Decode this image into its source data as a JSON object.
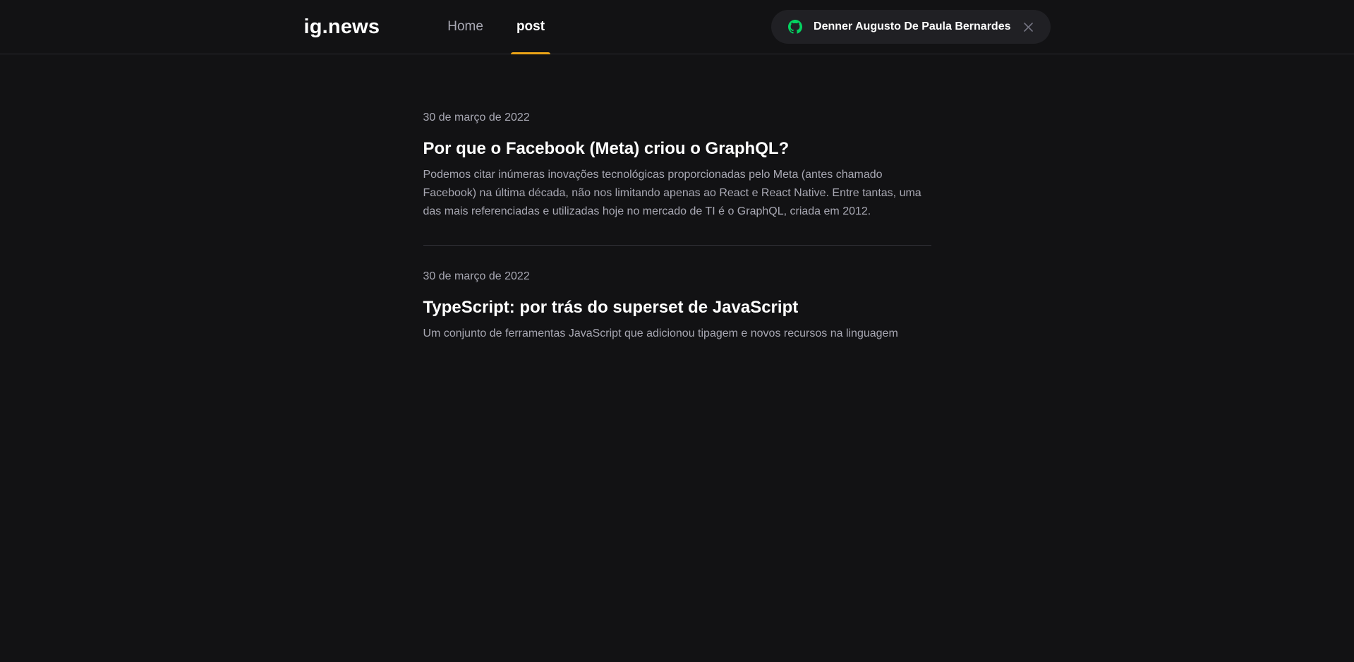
{
  "header": {
    "logo": "ig.news",
    "nav": [
      {
        "label": "Home",
        "active": false
      },
      {
        "label": "post",
        "active": true
      }
    ],
    "user": {
      "name": "Denner Augusto De Paula Bernardes",
      "icon": "github-icon",
      "close_icon": "close-icon"
    }
  },
  "posts": [
    {
      "date": "30 de março de 2022",
      "title": "Por que o Facebook (Meta) criou o GraphQL?",
      "excerpt": "Podemos citar inúmeras inovações tecnológicas proporcionadas pelo Meta (antes chamado Facebook) na última década, não nos limitando apenas ao React e React Native. Entre tantas, uma das mais referenciadas e utilizadas hoje no mercado de TI é o GraphQL, criada em 2012."
    },
    {
      "date": "30 de março de 2022",
      "title": "TypeScript: por trás do superset de JavaScript",
      "excerpt": "Um conjunto de ferramentas JavaScript que adicionou tipagem e novos recursos na linguagem"
    }
  ],
  "colors": {
    "background": "#121214",
    "accent": "#eba417",
    "github_icon": "#04d361",
    "text_muted": "#a8a8b3"
  }
}
